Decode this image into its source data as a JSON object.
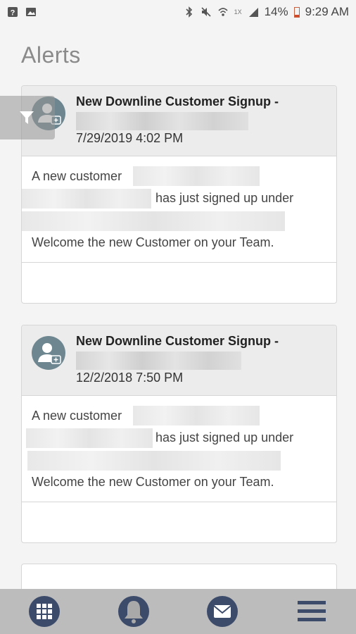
{
  "status_bar": {
    "network": "1X",
    "battery": "14%",
    "time": "9:29 AM"
  },
  "page": {
    "title": "Alerts"
  },
  "alerts": [
    {
      "title": "New Downline Customer Signup -",
      "date": "7/29/2019 4:02 PM",
      "line1": "A new customer",
      "line2": "has just signed up under",
      "line4": "Welcome the new Customer on your Team."
    },
    {
      "title": "New Downline Customer Signup -",
      "date": "12/2/2018 7:50 PM",
      "line1": "A new customer",
      "line2": "has just signed up under",
      "line4": "Welcome the new Customer on your Team."
    }
  ],
  "icons": {
    "filter": "filter-icon",
    "avatar": "user-add-icon",
    "nav": [
      "grid-icon",
      "bell-icon",
      "mail-icon",
      "menu-icon"
    ]
  },
  "colors": {
    "accent": "#3d4b6b",
    "avatar": "#6d8690",
    "nav_bg": "#bcbcbc"
  }
}
